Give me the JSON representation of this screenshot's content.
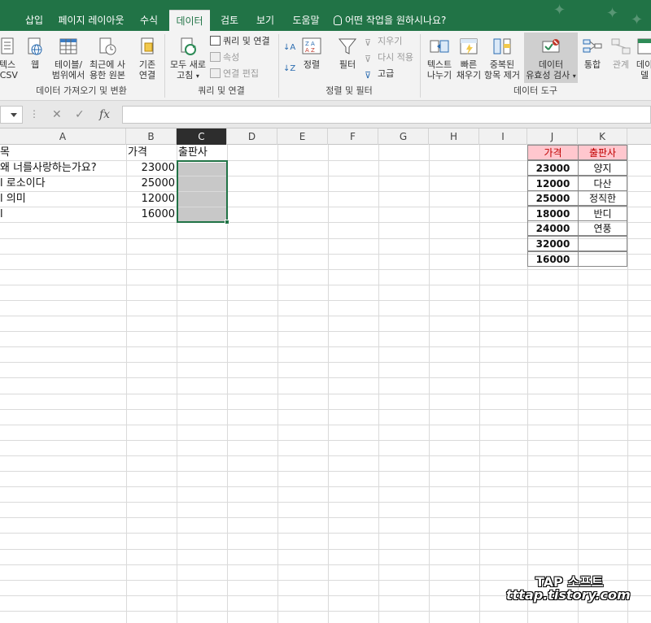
{
  "tabs": [
    "삽입",
    "페이지 레이아웃",
    "수식",
    "데이터",
    "검토",
    "보기",
    "도움말"
  ],
  "active_tab": "데이터",
  "tell_me": "어떤 작업을 원하시나요?",
  "ribbon": {
    "get_data": {
      "btn1": [
        "텍스",
        "/CSV"
      ],
      "btn2": [
        "웹"
      ],
      "btn3": [
        "테이블/",
        "범위에서"
      ],
      "btn4": [
        "최근에 사",
        "용한 원본"
      ],
      "btn5": [
        "기존",
        "연결"
      ],
      "group": "데이터 가져오기 및 변환"
    },
    "queries": {
      "refresh": [
        "모두 새로",
        "고침"
      ],
      "queries_connections": "쿼리 및 연결",
      "properties": "속성",
      "edit_links": "연결 편집",
      "group": "쿼리 및 연결"
    },
    "sort_filter": {
      "sort": "정렬",
      "filter": "필터",
      "clear": "지우기",
      "reapply": "다시 적용",
      "advanced": "고급",
      "group": "정렬 및 필터"
    },
    "tools": {
      "text_to_columns": [
        "텍스트",
        "나누기"
      ],
      "flash_fill": [
        "빠른",
        "채우기"
      ],
      "remove_duplicates": [
        "중복된",
        "항목 제거"
      ],
      "data_validation": [
        "데이터",
        "유효성 검사"
      ],
      "consolidate": "통합",
      "relationships": "관계",
      "model": "데이",
      "model2": "델",
      "group": "데이터 도구"
    }
  },
  "formula_bar": {
    "cancel": "✕",
    "enter": "✓",
    "fx": "fx",
    "value": ""
  },
  "columns": [
    "A",
    "B",
    "C",
    "D",
    "E",
    "F",
    "G",
    "H",
    "I",
    "J",
    "K"
  ],
  "sheet": {
    "header_a": "목",
    "header_b": "가격",
    "header_c": "출판사",
    "rows": [
      {
        "a": "왜 너를사랑하는가요?",
        "b": "23000"
      },
      {
        "a": "l 로소이다",
        "b": "25000"
      },
      {
        "a": "l 의미",
        "b": "12000"
      },
      {
        "a": "l",
        "b": "16000"
      }
    ]
  },
  "lookup": {
    "header_price": "가격",
    "header_publisher": "출판사",
    "rows": [
      {
        "price": "23000",
        "publisher": "양지"
      },
      {
        "price": "12000",
        "publisher": "다산"
      },
      {
        "price": "25000",
        "publisher": "정직한"
      },
      {
        "price": "18000",
        "publisher": "반디"
      },
      {
        "price": "24000",
        "publisher": "연풍"
      },
      {
        "price": "32000",
        "publisher": ""
      },
      {
        "price": "16000",
        "publisher": ""
      }
    ]
  },
  "watermark": {
    "line1": "TAP 소프트",
    "line2": "tttap.tistory.com"
  },
  "colors": {
    "excel_green": "#217346",
    "header_fill": "#ffc7ce",
    "header_text": "#c00000",
    "selection_fill": "#c8c8c8"
  }
}
